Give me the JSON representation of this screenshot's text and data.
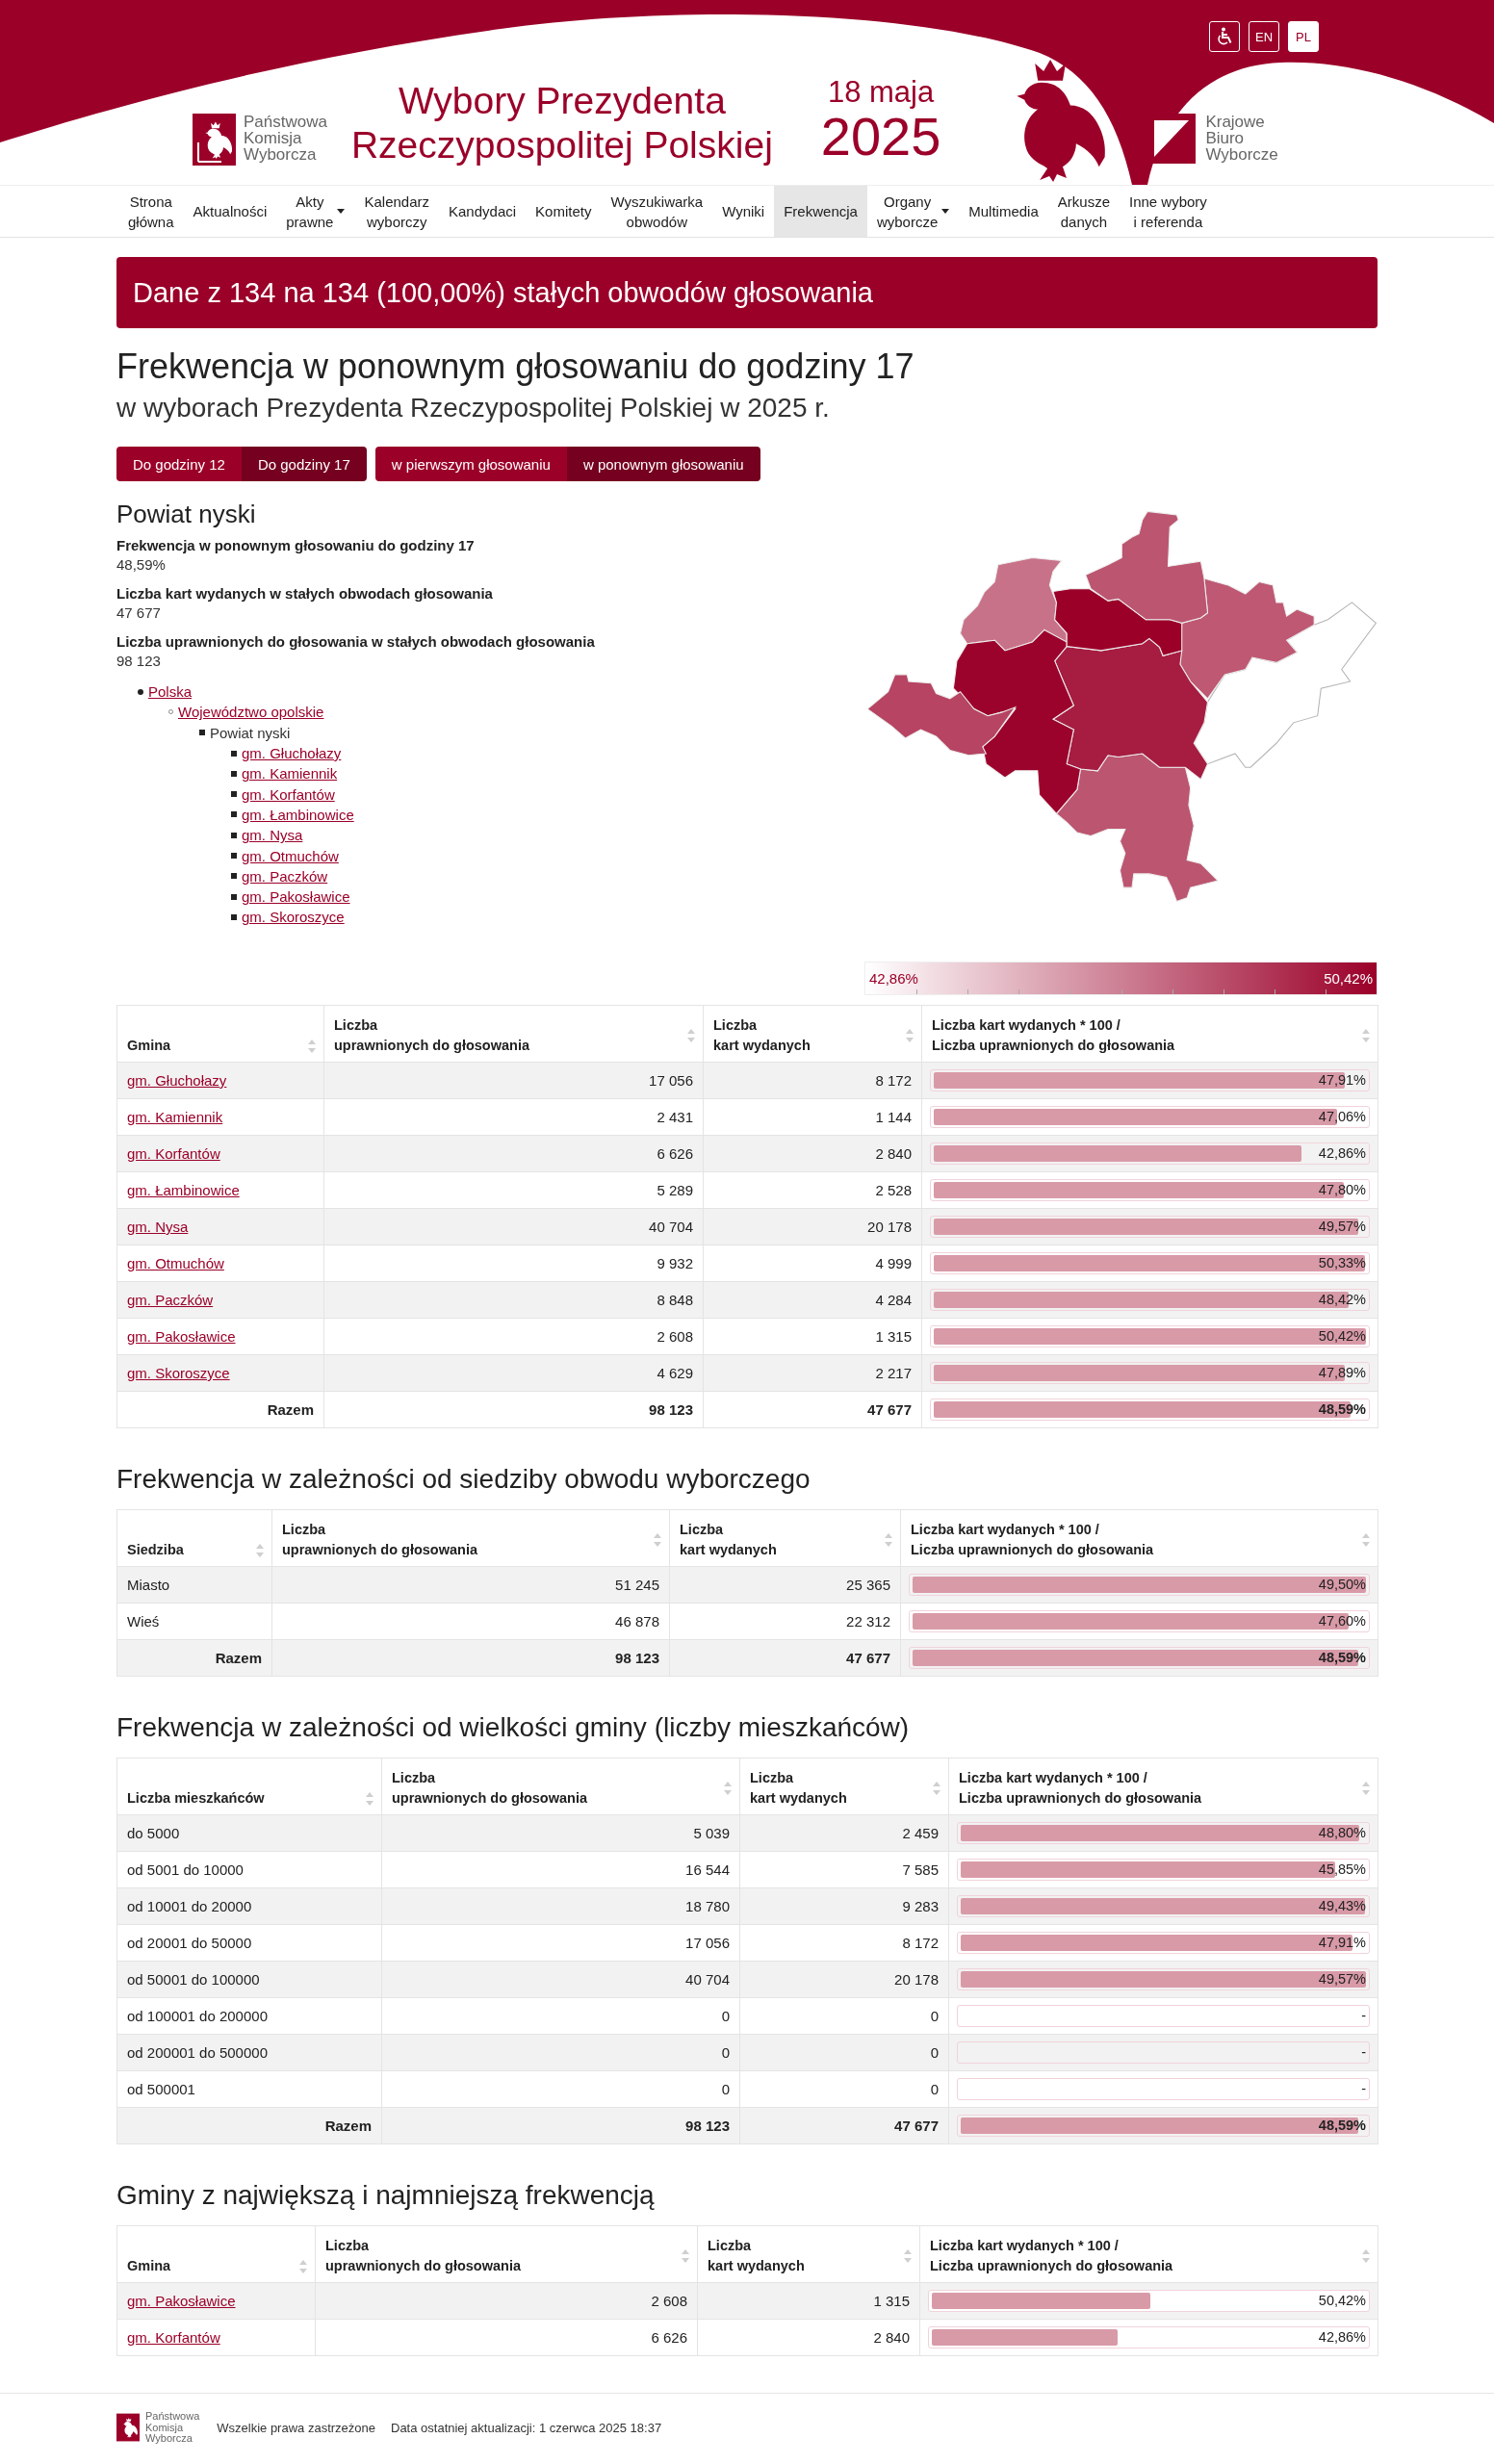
{
  "header": {
    "logo_left": [
      "Państwowa",
      "Komisja",
      "Wyborcza"
    ],
    "title": [
      "Wybory Prezydenta",
      "Rzeczypospolitej Polskiej"
    ],
    "date_day": "18 maja",
    "date_year": "2025",
    "logo_right": [
      "Krajowe",
      "Biuro",
      "Wyborcze"
    ],
    "languages": [
      {
        "label": "EN",
        "selected": false
      },
      {
        "label": "PL",
        "selected": true
      }
    ]
  },
  "nav": [
    {
      "label": "Strona\ngłówna",
      "selected": false,
      "dropdown": false
    },
    {
      "label": "Aktualności",
      "selected": false,
      "dropdown": false
    },
    {
      "label": "Akty\nprawne",
      "selected": false,
      "dropdown": true
    },
    {
      "label": "Kalendarz\nwyborczy",
      "selected": false,
      "dropdown": false
    },
    {
      "label": "Kandydaci",
      "selected": false,
      "dropdown": false
    },
    {
      "label": "Komitety",
      "selected": false,
      "dropdown": false
    },
    {
      "label": "Wyszukiwarka\nobwodów",
      "selected": false,
      "dropdown": false
    },
    {
      "label": "Wyniki",
      "selected": false,
      "dropdown": false
    },
    {
      "label": "Frekwencja",
      "selected": true,
      "dropdown": false
    },
    {
      "label": "Organy\nwyborcze",
      "selected": false,
      "dropdown": true
    },
    {
      "label": "Multimedia",
      "selected": false,
      "dropdown": false
    },
    {
      "label": "Arkusze\ndanych",
      "selected": false,
      "dropdown": false
    },
    {
      "label": "Inne wybory\ni referenda",
      "selected": false,
      "dropdown": false
    }
  ],
  "banner": "Dane z 134 na 134 (100,00%) stałych obwodów głosowania",
  "title": "Frekwencja w ponownym głosowaniu do godziny 17",
  "subtitle": "w wyborach Prezydenta Rzeczypospolitej Polskiej w 2025 r.",
  "filter_groups": [
    {
      "options": [
        {
          "label": "Do godziny 12",
          "selected": false
        },
        {
          "label": "Do godziny 17",
          "selected": true
        }
      ]
    },
    {
      "options": [
        {
          "label": "w pierwszym głosowaniu",
          "selected": false
        },
        {
          "label": "w ponownym głosowaniu",
          "selected": true
        }
      ]
    }
  ],
  "area": {
    "title": "Powiat nyski",
    "stats": [
      {
        "label": "Frekwencja w ponownym głosowaniu do godziny 17",
        "value": "48,59%"
      },
      {
        "label": "Liczba kart wydanych w stałych obwodach głosowania",
        "value": "47 677"
      },
      {
        "label": "Liczba uprawnionych do głosowania w stałych obwodach głosowania",
        "value": "98 123"
      }
    ],
    "tree": [
      {
        "label": "Polska",
        "link": true,
        "children": [
          {
            "label": "Województwo opolskie",
            "link": true,
            "children": [
              {
                "label": "Powiat nyski",
                "link": false,
                "children": [
                  {
                    "label": "gm. Głuchołazy",
                    "link": true
                  },
                  {
                    "label": "gm. Kamiennik",
                    "link": true
                  },
                  {
                    "label": "gm. Korfantów",
                    "link": true
                  },
                  {
                    "label": "gm. Łambinowice",
                    "link": true
                  },
                  {
                    "label": "gm. Nysa",
                    "link": true
                  },
                  {
                    "label": "gm. Otmuchów",
                    "link": true
                  },
                  {
                    "label": "gm. Paczków",
                    "link": true
                  },
                  {
                    "label": "gm. Pakosławice",
                    "link": true
                  },
                  {
                    "label": "gm. Skoroszyce",
                    "link": true
                  }
                ]
              }
            ]
          }
        ]
      }
    ]
  },
  "map": {
    "legend_min": "42,86%",
    "legend_max": "50,42%"
  },
  "tables": [
    {
      "columns": [
        "Gmina",
        "Liczba\nuprawnionych do głosowania",
        "Liczba\nkart wydanych",
        "Liczba kart wydanych * 100 /\nLiczba uprawnionych do głosowania"
      ],
      "rows": [
        {
          "kind": "data",
          "name": "gm. Głuchołazy",
          "link": true,
          "eligible": "17 056",
          "issued": "8 172",
          "turnout": "47,91%",
          "level": 0.95
        },
        {
          "kind": "data",
          "name": "gm. Kamiennik",
          "link": true,
          "eligible": "2 431",
          "issued": "1 144",
          "turnout": "47,06%",
          "level": 0.933
        },
        {
          "kind": "data",
          "name": "gm. Korfantów",
          "link": true,
          "eligible": "6 626",
          "issued": "2 840",
          "turnout": "42,86%",
          "level": 0.85
        },
        {
          "kind": "data",
          "name": "gm. Łambinowice",
          "link": true,
          "eligible": "5 289",
          "issued": "2 528",
          "turnout": "47,80%",
          "level": 0.948
        },
        {
          "kind": "data",
          "name": "gm. Nysa",
          "link": true,
          "eligible": "40 704",
          "issued": "20 178",
          "turnout": "49,57%",
          "level": 0.983
        },
        {
          "kind": "data",
          "name": "gm. Otmuchów",
          "link": true,
          "eligible": "9 932",
          "issued": "4 999",
          "turnout": "50,33%",
          "level": 0.998
        },
        {
          "kind": "data",
          "name": "gm. Paczków",
          "link": true,
          "eligible": "8 848",
          "issued": "4 284",
          "turnout": "48,42%",
          "level": 0.96
        },
        {
          "kind": "data",
          "name": "gm. Pakosławice",
          "link": true,
          "eligible": "2 608",
          "issued": "1 315",
          "turnout": "50,42%",
          "level": 1.0
        },
        {
          "kind": "data",
          "name": "gm. Skoroszyce",
          "link": true,
          "eligible": "4 629",
          "issued": "2 217",
          "turnout": "47,89%",
          "level": 0.95
        },
        {
          "kind": "total",
          "name": "Razem",
          "link": false,
          "eligible": "98 123",
          "issued": "47 677",
          "turnout": "48,59%",
          "level": 0.964
        }
      ]
    },
    {
      "heading": "Frekwencja w zależności od siedziby obwodu wyborczego",
      "columns": [
        "Siedziba",
        "Liczba\nuprawnionych do głosowania",
        "Liczba\nkart wydanych",
        "Liczba kart wydanych * 100 /\nLiczba uprawnionych do głosowania"
      ],
      "rows": [
        {
          "kind": "data",
          "name": "Miasto",
          "link": false,
          "eligible": "51 245",
          "issued": "25 365",
          "turnout": "49,50%",
          "level": 1.0
        },
        {
          "kind": "data",
          "name": "Wieś",
          "link": false,
          "eligible": "46 878",
          "issued": "22 312",
          "turnout": "47,60%",
          "level": 0.962
        },
        {
          "kind": "total",
          "name": "Razem",
          "link": false,
          "eligible": "98 123",
          "issued": "47 677",
          "turnout": "48,59%",
          "level": 0.982
        }
      ]
    },
    {
      "heading": "Frekwencja w zależności od wielkości gminy (liczby mieszkańców)",
      "columns": [
        "Liczba mieszkańców",
        "Liczba\nuprawnionych do głosowania",
        "Liczba\nkart wydanych",
        "Liczba kart wydanych * 100 /\nLiczba uprawnionych do głosowania"
      ],
      "rows": [
        {
          "kind": "data",
          "name": "do 5000",
          "link": false,
          "eligible": "5 039",
          "issued": "2 459",
          "turnout": "48,80%",
          "level": 0.984
        },
        {
          "kind": "data",
          "name": "od 5001 do 10000",
          "link": false,
          "eligible": "16 544",
          "issued": "7 585",
          "turnout": "45,85%",
          "level": 0.925
        },
        {
          "kind": "data",
          "name": "od 10001 do 20000",
          "link": false,
          "eligible": "18 780",
          "issued": "9 283",
          "turnout": "49,43%",
          "level": 0.997
        },
        {
          "kind": "data",
          "name": "od 20001 do 50000",
          "link": false,
          "eligible": "17 056",
          "issued": "8 172",
          "turnout": "47,91%",
          "level": 0.966
        },
        {
          "kind": "data",
          "name": "od 50001 do 100000",
          "link": false,
          "eligible": "40 704",
          "issued": "20 178",
          "turnout": "49,57%",
          "level": 1.0
        },
        {
          "kind": "data",
          "name": "od 100001 do 200000",
          "link": false,
          "eligible": "0",
          "issued": "0",
          "turnout": "-"
        },
        {
          "kind": "data",
          "name": "od 200001 do 500000",
          "link": false,
          "eligible": "0",
          "issued": "0",
          "turnout": "-"
        },
        {
          "kind": "data",
          "name": "od 500001",
          "link": false,
          "eligible": "0",
          "issued": "0",
          "turnout": "-"
        },
        {
          "kind": "total",
          "name": "Razem",
          "link": false,
          "eligible": "98 123",
          "issued": "47 677",
          "turnout": "48,59%",
          "level": 0.98
        }
      ]
    },
    {
      "heading": "Gminy z największą i najmniejszą frekwencją",
      "columns": [
        "Gmina",
        "Liczba\nuprawnionych do głosowania",
        "Liczba\nkart wydanych",
        "Liczba kart wydanych * 100 /\nLiczba uprawnionych do głosowania"
      ],
      "rows": [
        {
          "kind": "data",
          "name": "gm. Pakosławice",
          "link": true,
          "eligible": "2 608",
          "issued": "1 315",
          "turnout": "50,42%",
          "level": 0.5042
        },
        {
          "kind": "data",
          "name": "gm. Korfantów",
          "link": true,
          "eligible": "6 626",
          "issued": "2 840",
          "turnout": "42,86%",
          "level": 0.4286
        }
      ]
    }
  ],
  "footer": {
    "logo": [
      "Państwowa",
      "Komisja",
      "Wyborcza"
    ],
    "rights": "Wszelkie prawa zastrzeżone",
    "updated": "Data ostatniej aktualizacji: 1 czerwca 2025 18:37"
  }
}
